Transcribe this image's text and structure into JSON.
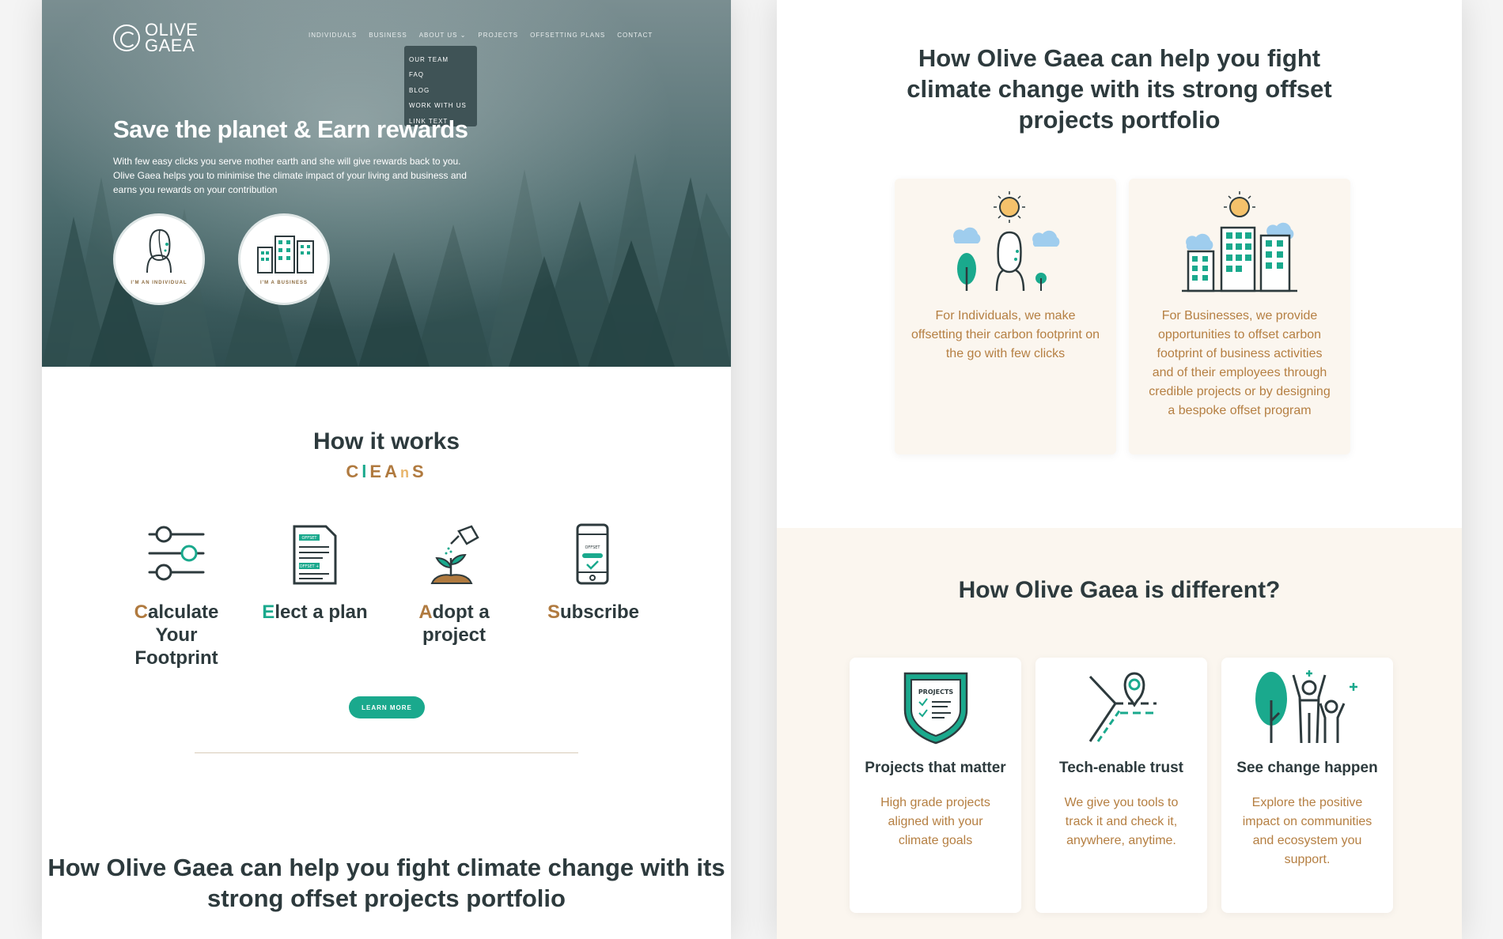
{
  "brand": {
    "logo_line1": "OLIVE",
    "logo_line2": "GAEA"
  },
  "nav": {
    "items": [
      "INDIVIDUALS",
      "BUSINESS",
      "ABOUT US",
      "PROJECTS",
      "OFFSETTING PLANS",
      "CONTACT"
    ],
    "dropdown": [
      "OUR TEAM",
      "FAQ",
      "BLOG",
      "WORK WITH US",
      "LINK TEXT"
    ]
  },
  "hero": {
    "title": "Save the planet & Earn rewards",
    "subtitle": "With few easy clicks you serve mother earth and she will give rewards back to you. Olive Gaea helps you to minimise the climate impact of your living and business and earns you rewards on your contribution",
    "individual_cta": "I'M AN INDIVIDUAL",
    "business_cta": "I'M A BUSINESS"
  },
  "how_it_works": {
    "title": "How it works",
    "acronym": [
      "C",
      "l",
      "E",
      "A",
      "n",
      "S"
    ],
    "steps": [
      {
        "first": "C",
        "rest": "alculate Your Footprint"
      },
      {
        "first": "E",
        "rest": "lect a plan"
      },
      {
        "first": "A",
        "rest": "dopt a project"
      },
      {
        "first": "S",
        "rest": "ubscribe"
      }
    ],
    "step_icon_texts": {
      "plan_badge_1": "OFFSET",
      "plan_badge_2": "OFFSET +",
      "phone_text": "OFFSET"
    },
    "learn_more": "LEARN MORE"
  },
  "portfolio": {
    "title": "How Olive Gaea can help you fight climate change with its strong offset projects portfolio",
    "cards": [
      {
        "text": "For Individuals, we make offsetting their carbon footprint on the go with few clicks"
      },
      {
        "text": "For Businesses, we provide opportunities to offset carbon footprint of business activities and of their employees through credible projects or by designing a bespoke offset program"
      }
    ]
  },
  "different": {
    "title": "How Olive Gaea is different?",
    "shield_text": "PROJECTS",
    "cards": [
      {
        "title": "Projects that matter",
        "text": "High grade projects aligned with your climate goals"
      },
      {
        "title": "Tech-enable trust",
        "text": "We give you tools to track it and check it, anywhere, anytime."
      },
      {
        "title": "See change happen",
        "text": "Explore the positive impact on communities and ecosystem you support."
      }
    ]
  },
  "colors": {
    "teal": "#1aa98d",
    "brown": "#b07a3f",
    "dark": "#2d3a3d",
    "cream": "#fbf6ef",
    "sun": "#f5c26b"
  }
}
